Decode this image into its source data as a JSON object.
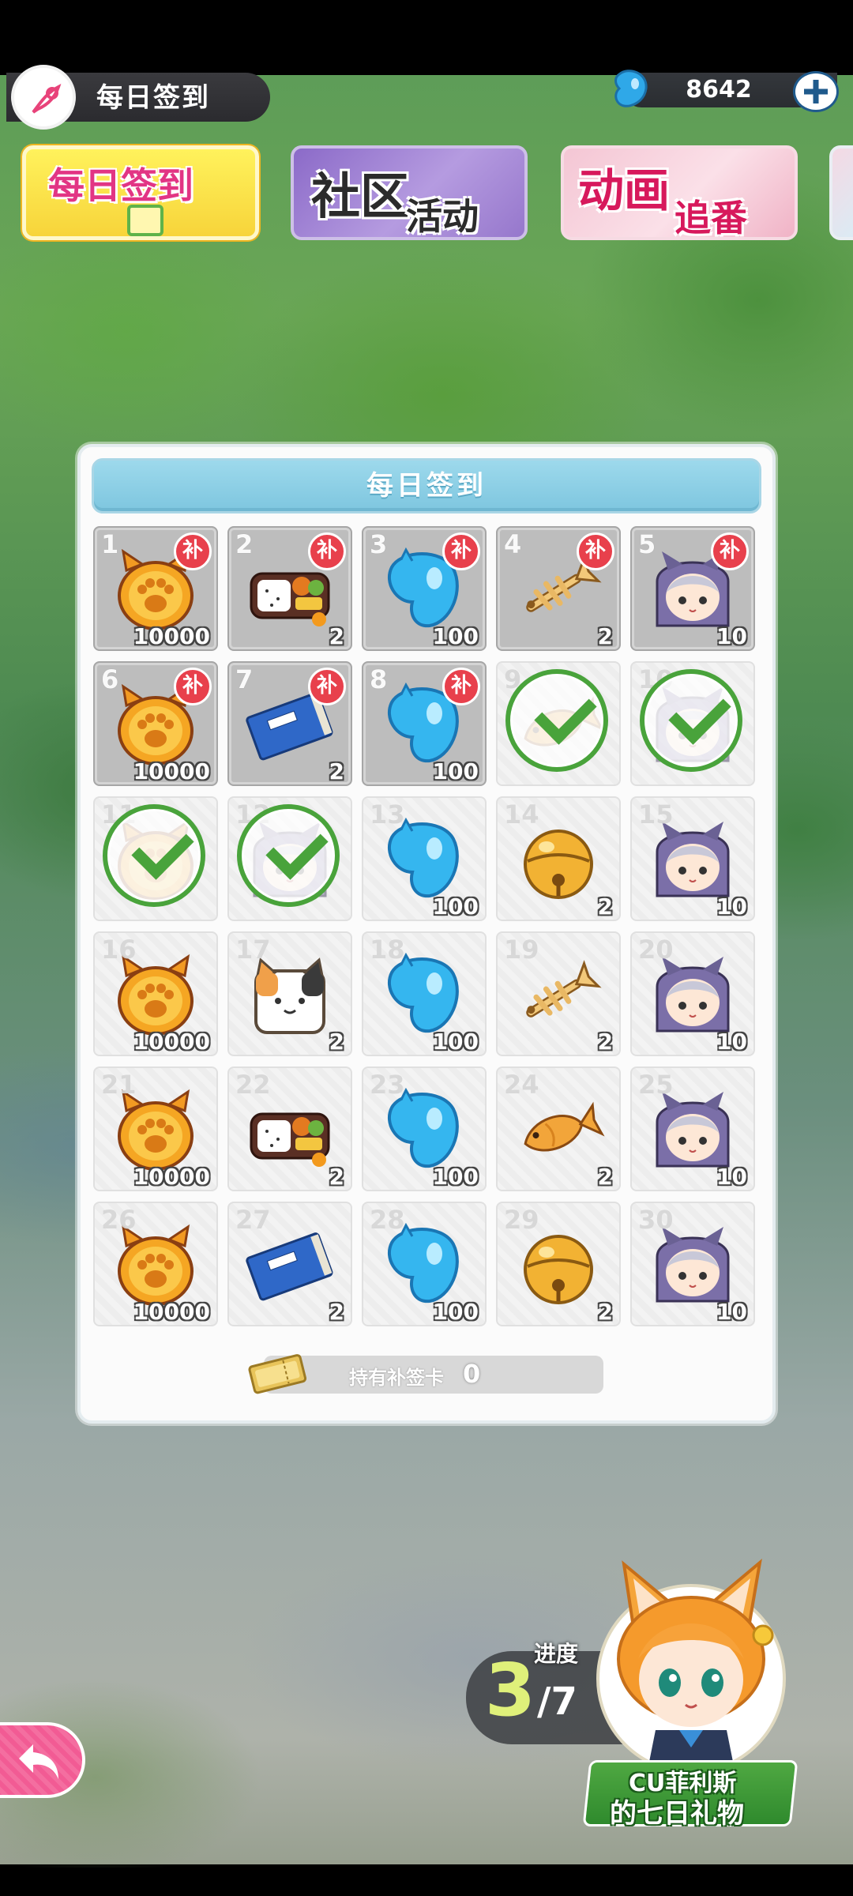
{
  "header": {
    "title": "每日签到",
    "currency_value": "8642"
  },
  "banners": {
    "checkin": "每日签到",
    "community_1": "社区",
    "community_2": "活动",
    "anime_1": "动画",
    "anime_2": "追番"
  },
  "panel": {
    "title": "每日签到"
  },
  "makeup_badge": "补",
  "days": [
    {
      "day": "1",
      "qty": "10000",
      "item": "paw-coin",
      "state": "makeup"
    },
    {
      "day": "2",
      "qty": "2",
      "item": "bento",
      "state": "makeup"
    },
    {
      "day": "3",
      "qty": "100",
      "item": "blue-drop",
      "state": "makeup"
    },
    {
      "day": "4",
      "qty": "2",
      "item": "fish-bone",
      "state": "makeup"
    },
    {
      "day": "5",
      "qty": "10",
      "item": "character-card",
      "state": "makeup"
    },
    {
      "day": "6",
      "qty": "10000",
      "item": "paw-coin",
      "state": "makeup"
    },
    {
      "day": "7",
      "qty": "2",
      "item": "blue-book",
      "state": "makeup"
    },
    {
      "day": "8",
      "qty": "100",
      "item": "blue-drop",
      "state": "makeup"
    },
    {
      "day": "9",
      "qty": "",
      "item": "golden-fish",
      "state": "checked"
    },
    {
      "day": "10",
      "qty": "",
      "item": "character-card",
      "state": "checked"
    },
    {
      "day": "11",
      "qty": "",
      "item": "paw-coin",
      "state": "checked"
    },
    {
      "day": "12",
      "qty": "",
      "item": "character-card",
      "state": "checked"
    },
    {
      "day": "13",
      "qty": "100",
      "item": "blue-drop",
      "state": "open"
    },
    {
      "day": "14",
      "qty": "2",
      "item": "golden-bell",
      "state": "open"
    },
    {
      "day": "15",
      "qty": "10",
      "item": "character-card",
      "state": "open"
    },
    {
      "day": "16",
      "qty": "10000",
      "item": "paw-coin",
      "state": "open"
    },
    {
      "day": "17",
      "qty": "2",
      "item": "cat-tofu",
      "state": "open"
    },
    {
      "day": "18",
      "qty": "100",
      "item": "blue-drop",
      "state": "open"
    },
    {
      "day": "19",
      "qty": "2",
      "item": "fish-bone",
      "state": "open"
    },
    {
      "day": "20",
      "qty": "10",
      "item": "character-card",
      "state": "open"
    },
    {
      "day": "21",
      "qty": "10000",
      "item": "paw-coin",
      "state": "open"
    },
    {
      "day": "22",
      "qty": "2",
      "item": "bento",
      "state": "open"
    },
    {
      "day": "23",
      "qty": "100",
      "item": "blue-drop",
      "state": "open"
    },
    {
      "day": "24",
      "qty": "2",
      "item": "golden-fish",
      "state": "open"
    },
    {
      "day": "25",
      "qty": "10",
      "item": "character-card",
      "state": "open"
    },
    {
      "day": "26",
      "qty": "10000",
      "item": "paw-coin",
      "state": "open"
    },
    {
      "day": "27",
      "qty": "2",
      "item": "blue-book",
      "state": "open"
    },
    {
      "day": "28",
      "qty": "100",
      "item": "blue-drop",
      "state": "open"
    },
    {
      "day": "29",
      "qty": "2",
      "item": "golden-bell",
      "state": "open"
    },
    {
      "day": "30",
      "qty": "10",
      "item": "character-card",
      "state": "open"
    }
  ],
  "makeup_card": {
    "label": "持有补签卡",
    "count": "0"
  },
  "progress": {
    "label": "进度",
    "current": "3",
    "total": "/7"
  },
  "gift": {
    "line1": "CU菲利斯",
    "line2": "的七日礼物"
  }
}
